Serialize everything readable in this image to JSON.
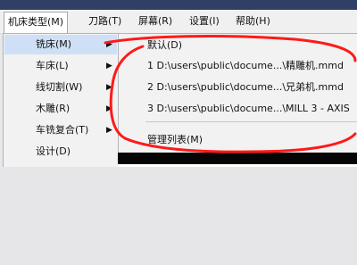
{
  "menubar": {
    "items": [
      {
        "label": "机床类型(M)"
      },
      {
        "label": "刀路(T)"
      },
      {
        "label": "屏幕(R)"
      },
      {
        "label": "设置(I)"
      },
      {
        "label": "帮助(H)"
      }
    ]
  },
  "machine_menu": {
    "items": [
      {
        "label": "铣床(M)",
        "arrow": "▶"
      },
      {
        "label": "车床(L)",
        "arrow": "▶"
      },
      {
        "label": "线切割(W)",
        "arrow": "▶"
      },
      {
        "label": "木雕(R)",
        "arrow": "▶"
      },
      {
        "label": "车铣复合(T)",
        "arrow": "▶"
      },
      {
        "label": "设计(D)"
      }
    ]
  },
  "mill_submenu": {
    "items": [
      {
        "label": "默认(D)"
      },
      {
        "label": "1  D:\\users\\public\\docume...\\精雕机.mmd"
      },
      {
        "label": "2  D:\\users\\public\\docume...\\兄弟机.mmd"
      },
      {
        "label": "3  D:\\users\\public\\docume...\\MILL 3 - AXIS"
      }
    ],
    "manage": {
      "label": "管理列表(M)"
    }
  },
  "annotation_color": "#ff1a1a"
}
